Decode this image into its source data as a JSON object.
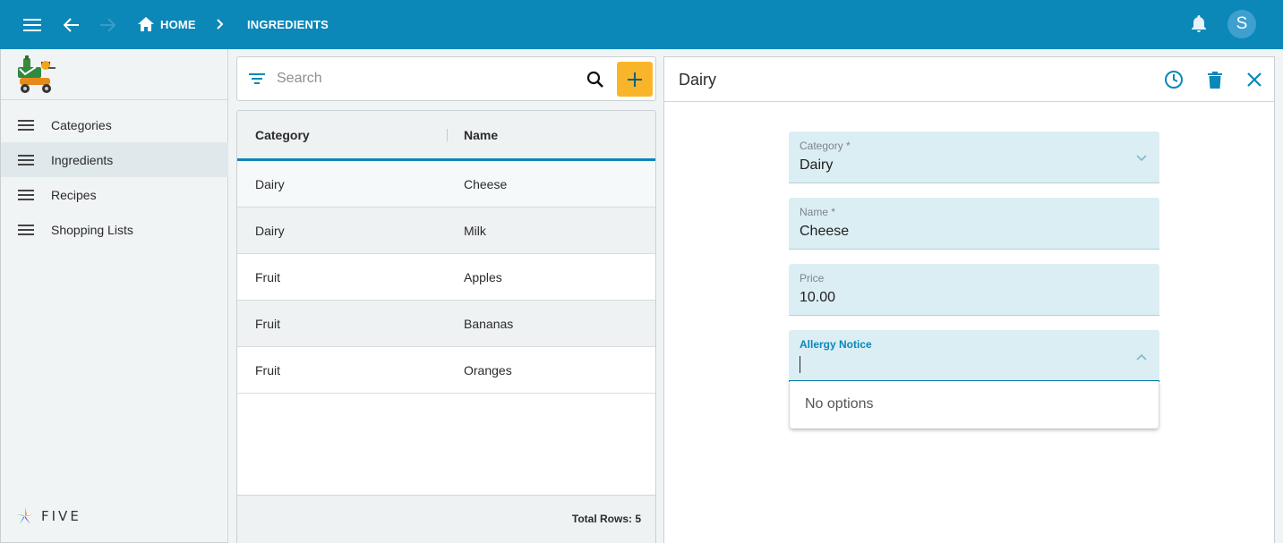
{
  "header": {
    "breadcrumbs": [
      {
        "label": "HOME"
      },
      {
        "label": "INGREDIENTS"
      }
    ],
    "avatar_letter": "S"
  },
  "sidebar": {
    "items": [
      {
        "label": "Categories",
        "active": false
      },
      {
        "label": "Ingredients",
        "active": true
      },
      {
        "label": "Recipes",
        "active": false
      },
      {
        "label": "Shopping Lists",
        "active": false
      }
    ],
    "brand": "FIVE"
  },
  "search": {
    "placeholder": "Search",
    "value": ""
  },
  "table": {
    "columns": [
      "Category",
      "Name"
    ],
    "rows": [
      {
        "category": "Dairy",
        "name": "Cheese"
      },
      {
        "category": "Dairy",
        "name": "Milk"
      },
      {
        "category": "Fruit",
        "name": "Apples"
      },
      {
        "category": "Fruit",
        "name": "Bananas"
      },
      {
        "category": "Fruit",
        "name": "Oranges"
      }
    ],
    "total_rows": "Total Rows: 5"
  },
  "detail": {
    "title": "Dairy",
    "fields": [
      {
        "label": "Category *",
        "value": "Dairy"
      },
      {
        "label": "Name *",
        "value": "Cheese"
      },
      {
        "label": "Price",
        "value": "10.00"
      },
      {
        "label": "Allergy Notice",
        "value": ""
      }
    ],
    "dropdown_message": "No options"
  },
  "colors": {
    "primary": "#0b87b8",
    "accent": "#f9b52a",
    "field_bg": "#dbeef4"
  }
}
